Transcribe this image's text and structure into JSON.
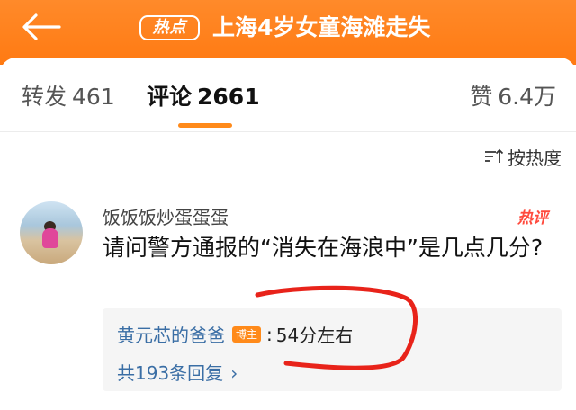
{
  "header": {
    "hot_badge": "热点",
    "title": "上海4岁女童海滩走失"
  },
  "tabs": [
    {
      "label": "转发",
      "count": "461"
    },
    {
      "label": "评论",
      "count": "2661"
    },
    {
      "label": "赞",
      "count": "6.4万"
    }
  ],
  "sort": {
    "label": "按热度"
  },
  "comment": {
    "username": "饭饭饭炒蛋蛋蛋",
    "hot_tag": "热评",
    "text": "请问警方通报的“消失在海浪中”是几点几分?",
    "reply": {
      "author": "黄元芯的爸爸",
      "badge": "博主",
      "colon": ":",
      "text": "54分左右",
      "count_label": "共193条回复"
    }
  },
  "colors": {
    "header": "#ff7a12",
    "accent": "#ff8a1a",
    "link": "#3a6ea5",
    "annotation": "#e8231a"
  }
}
